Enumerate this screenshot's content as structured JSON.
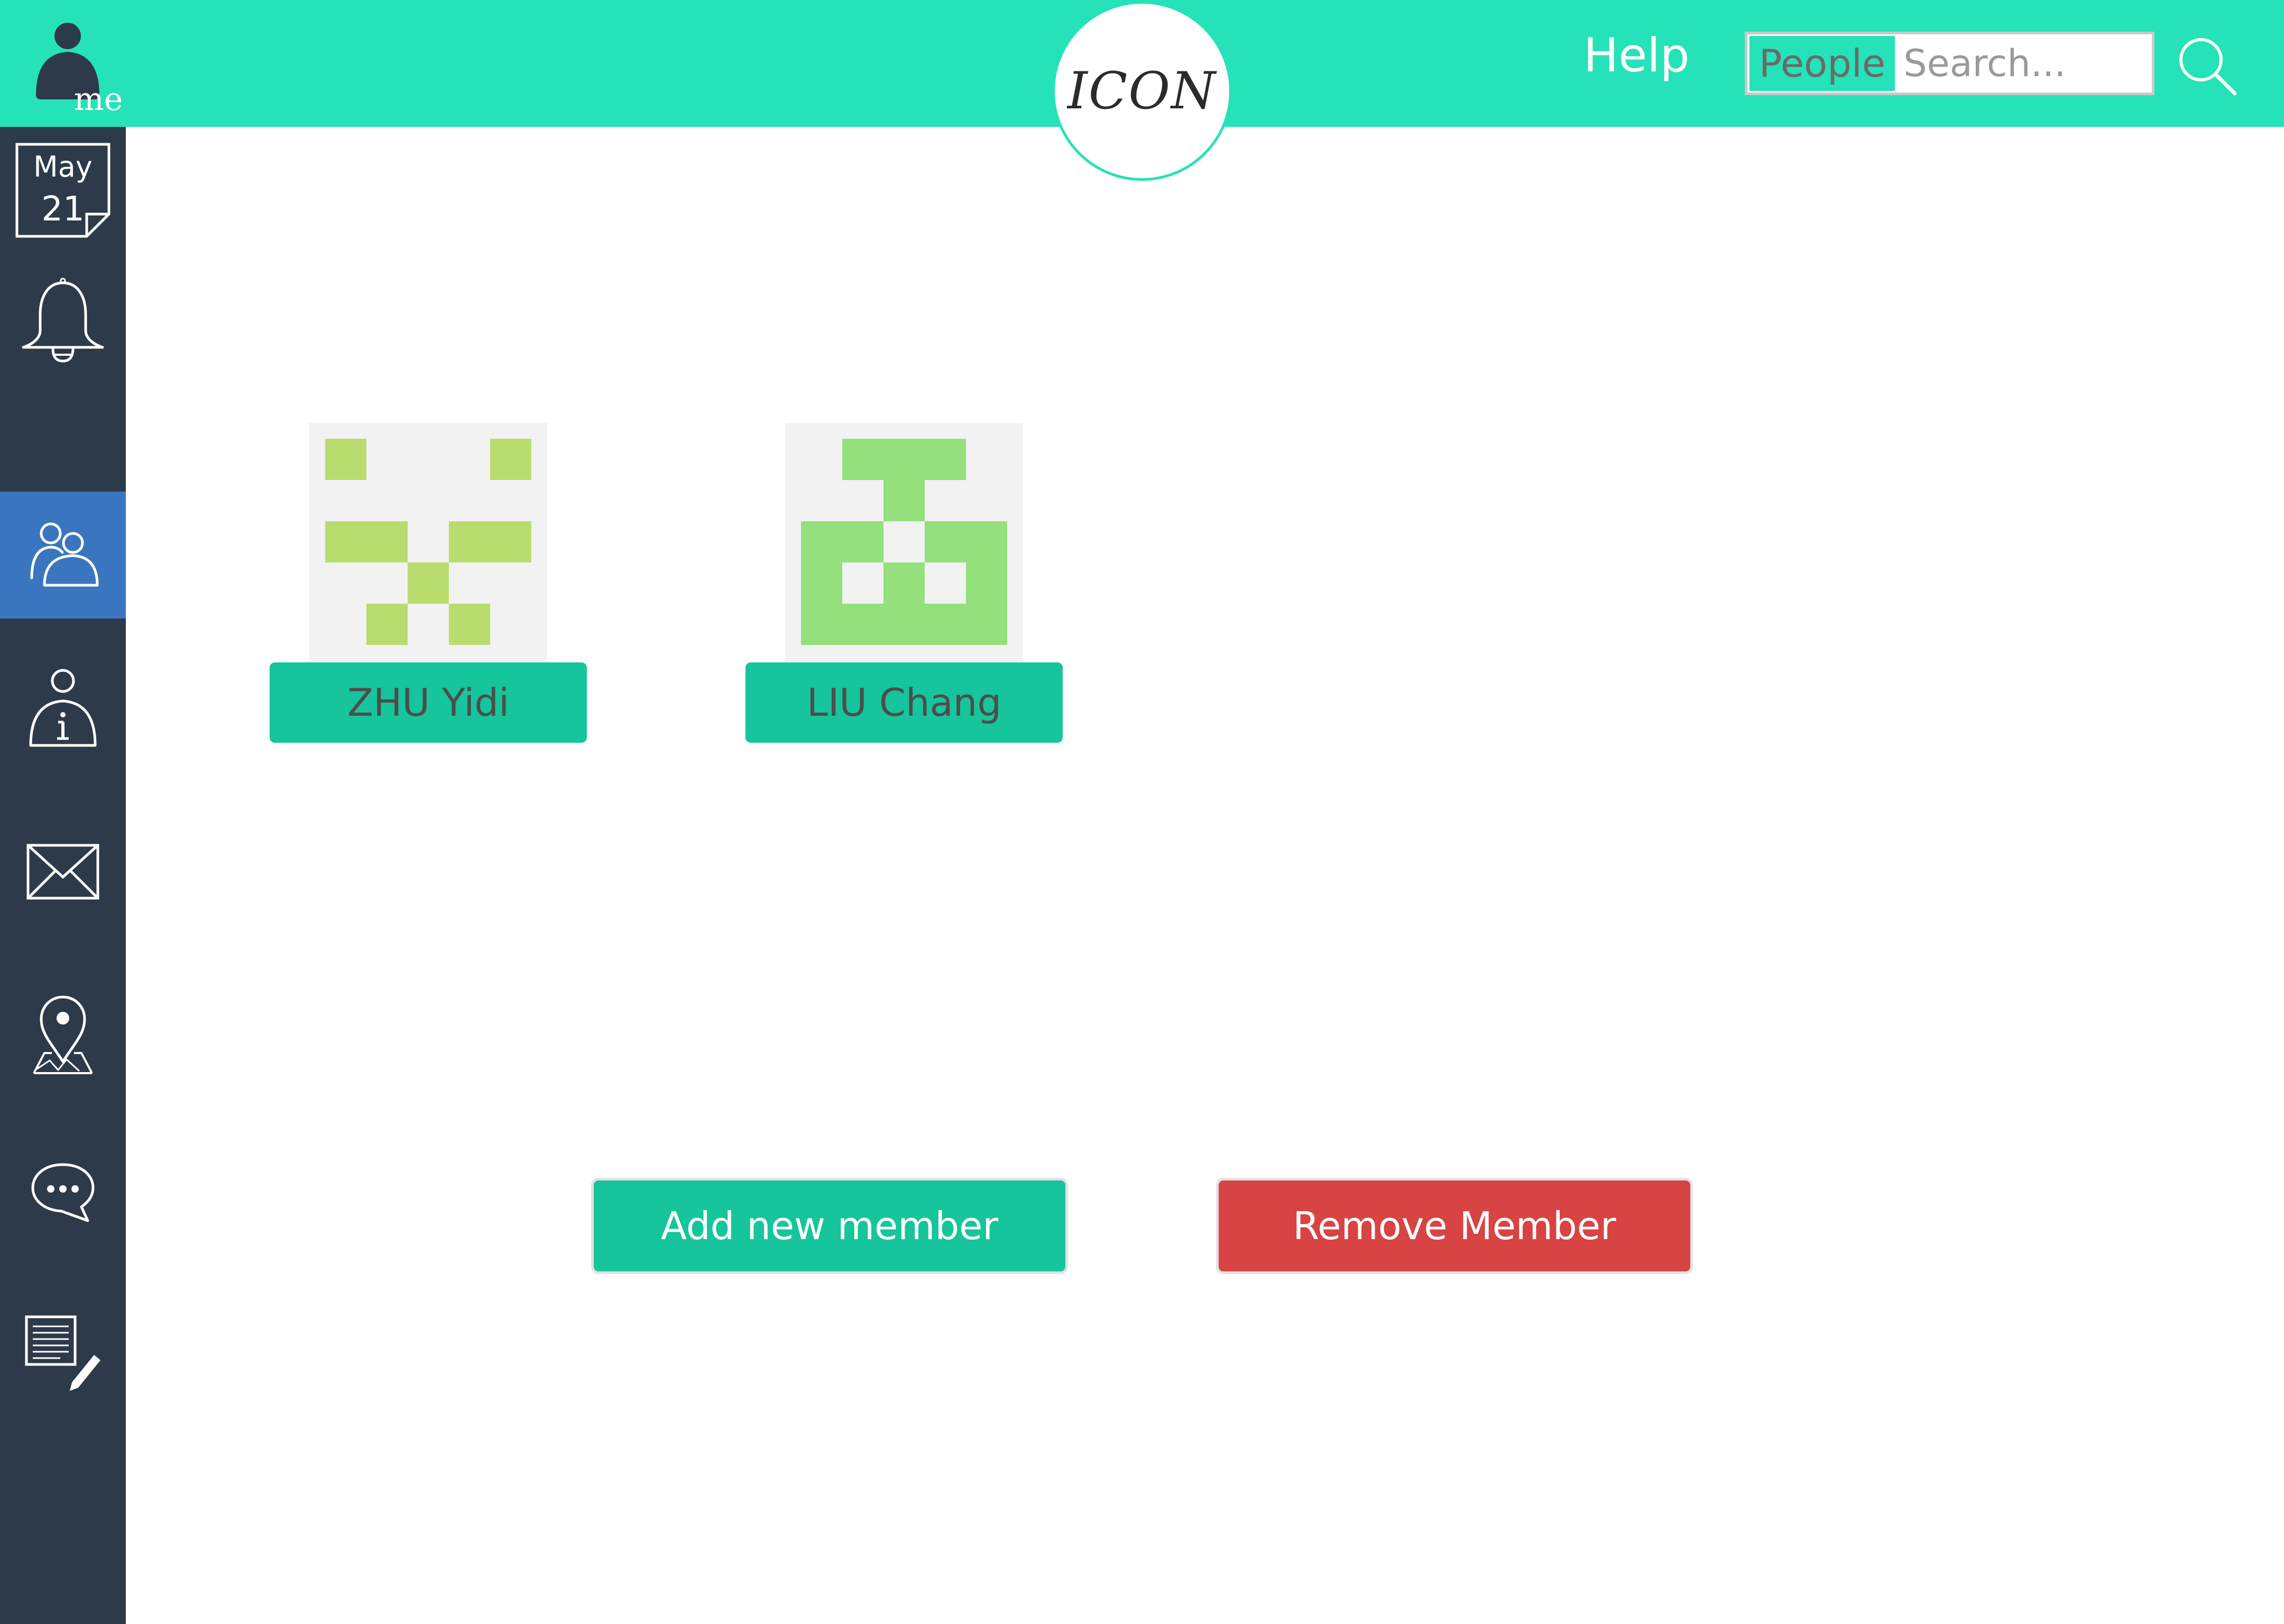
{
  "header": {
    "me_label": "me",
    "logo_text": "ICON",
    "help_label": "Help",
    "search": {
      "scope": "People",
      "placeholder": "Search..."
    },
    "search_icon": "magnifier-icon",
    "background_color": "#26e2b8"
  },
  "sidebar": {
    "background_color": "#2c3a4a",
    "active_color": "#3a76bf",
    "items": [
      {
        "name": "calendar",
        "icon": "calendar-icon",
        "month": "May",
        "day": "21",
        "active": false
      },
      {
        "name": "notifications",
        "icon": "bell-icon",
        "active": false
      },
      {
        "name": "people",
        "icon": "people-icon",
        "active": true
      },
      {
        "name": "profile-info",
        "icon": "user-info-icon",
        "active": false
      },
      {
        "name": "mail",
        "icon": "envelope-icon",
        "active": false
      },
      {
        "name": "map",
        "icon": "map-pin-icon",
        "active": false
      },
      {
        "name": "chat",
        "icon": "chat-bubble-icon",
        "active": false
      },
      {
        "name": "notes",
        "icon": "note-edit-icon",
        "active": false
      }
    ]
  },
  "members": [
    {
      "name": "ZHU Yidi",
      "avatar_icon": "identicon-avatar",
      "avatar_color": "#b9dc6f"
    },
    {
      "name": "LIU Chang",
      "avatar_icon": "identicon-avatar",
      "avatar_color": "#93e07c"
    }
  ],
  "actions": {
    "add_label": "Add new member",
    "remove_label": "Remove Member",
    "add_color": "#16c59b",
    "remove_color": "#d84343"
  }
}
